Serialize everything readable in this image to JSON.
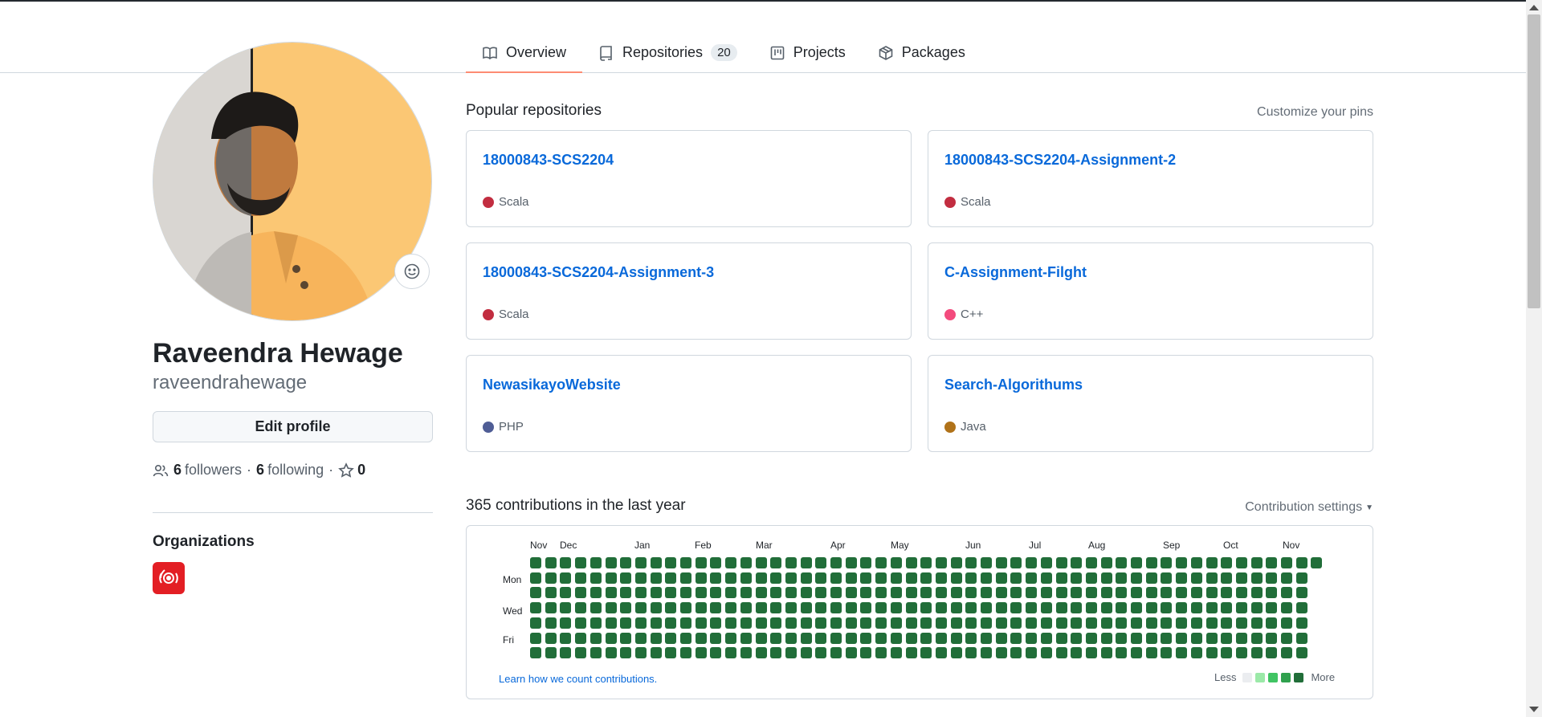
{
  "tabs": [
    {
      "label": "Overview",
      "icon": "book-icon",
      "active": true
    },
    {
      "label": "Repositories",
      "icon": "repo-icon",
      "count": "20"
    },
    {
      "label": "Projects",
      "icon": "project-icon"
    },
    {
      "label": "Packages",
      "icon": "package-icon"
    }
  ],
  "profile": {
    "name": "Raveendra Hewage",
    "login": "raveendrahewage",
    "edit_label": "Edit profile",
    "followers_count": "6",
    "followers_label": "followers",
    "following_count": "6",
    "following_label": "following",
    "stars_count": "0",
    "separator": "·"
  },
  "organizations": {
    "title": "Organizations",
    "items": [
      {
        "icon": "organization-logo-icon",
        "color": "#e31e24"
      }
    ]
  },
  "popular": {
    "title": "Popular repositories",
    "customize_label": "Customize your pins",
    "repos": [
      {
        "name": "18000843-SCS2204",
        "language": "Scala",
        "color": "#c22d40"
      },
      {
        "name": "18000843-SCS2204-Assignment-2",
        "language": "Scala",
        "color": "#c22d40"
      },
      {
        "name": "18000843-SCS2204-Assignment-3",
        "language": "Scala",
        "color": "#c22d40"
      },
      {
        "name": "C-Assignment-Filght",
        "language": "C++",
        "color": "#f34b7d"
      },
      {
        "name": "NewasikayoWebsite",
        "language": "PHP",
        "color": "#4F5D95"
      },
      {
        "name": "Search-Algorithums",
        "language": "Java",
        "color": "#b07219"
      }
    ]
  },
  "contributions": {
    "title": "365 contributions in the last year",
    "settings_label": "Contribution settings",
    "months": [
      "Nov",
      "Dec",
      "Jan",
      "Feb",
      "Mar",
      "Apr",
      "May",
      "Jun",
      "Jul",
      "Aug",
      "Sep",
      "Oct",
      "Nov"
    ],
    "day_labels": [
      "Mon",
      "Wed",
      "Fri"
    ],
    "learn_label": "Learn how we count contributions.",
    "legend_less": "Less",
    "legend_more": "More",
    "legend_colors": [
      "#ebedf0",
      "#9be9a8",
      "#40c463",
      "#30a14e",
      "#216e39"
    ],
    "cell_color": "#216e39"
  }
}
